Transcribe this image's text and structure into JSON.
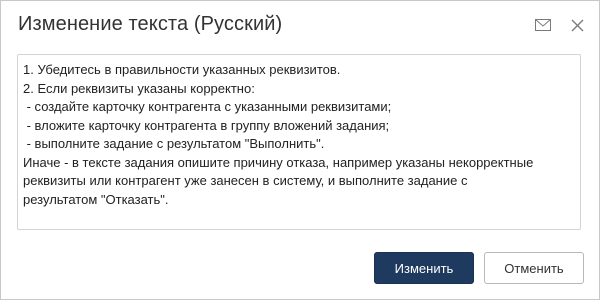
{
  "dialog": {
    "title": "Изменение текста (Русский)",
    "icons": [
      "mail-icon",
      "close-icon"
    ]
  },
  "textarea": {
    "lines": [
      "1. Убедитесь в правильности указанных реквизитов.",
      "2. Если реквизиты указаны корректно:",
      " - создайте карточку контрагента с указанными реквизитами;",
      " - вложите карточку контрагента в группу вложений задания;",
      " - выполните задание с результатом \"Выполнить\".",
      "Иначе - в тексте задания опишите причину отказа, например указаны некорректные",
      "реквизиты или контрагент уже занесен в систему, и выполните задание с",
      "результатом \"Отказать\"."
    ]
  },
  "buttons": {
    "primary_label": "Изменить",
    "secondary_label": "Отменить"
  },
  "colors": {
    "primary": "#1f3a5f",
    "border": "#c8c8c8"
  }
}
